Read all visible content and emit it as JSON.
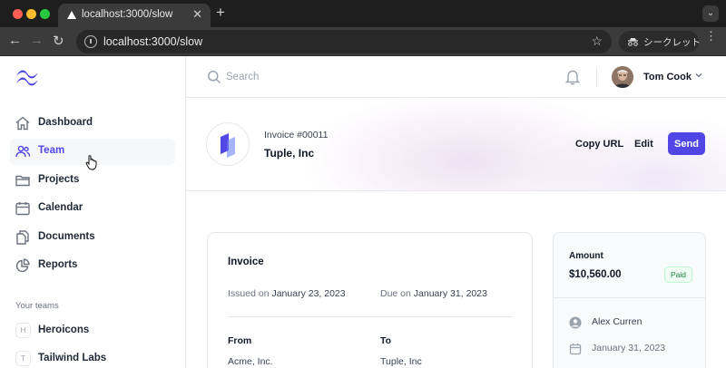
{
  "browser": {
    "tab_title": "localhost:3000/slow",
    "url": "localhost:3000/slow",
    "incognito_label": "シークレット"
  },
  "sidebar": {
    "items": [
      {
        "label": "Dashboard",
        "icon": "home-icon"
      },
      {
        "label": "Team",
        "icon": "users-icon"
      },
      {
        "label": "Projects",
        "icon": "folder-icon"
      },
      {
        "label": "Calendar",
        "icon": "calendar-icon"
      },
      {
        "label": "Documents",
        "icon": "documents-icon"
      },
      {
        "label": "Reports",
        "icon": "pie-chart-icon"
      }
    ],
    "active_item": "Team",
    "teams_title": "Your teams",
    "teams": [
      {
        "initial": "H",
        "label": "Heroicons"
      },
      {
        "initial": "T",
        "label": "Tailwind Labs"
      }
    ]
  },
  "topbar": {
    "search_placeholder": "Search",
    "user_name": "Tom Cook"
  },
  "header": {
    "invoice_number": "Invoice #00011",
    "company": "Tuple, Inc",
    "copy_url_label": "Copy URL",
    "edit_label": "Edit",
    "send_label": "Send"
  },
  "invoice": {
    "title": "Invoice",
    "issued_prefix": "Issued on",
    "issued_date": "January 23, 2023",
    "due_prefix": "Due on",
    "due_date": "January 31, 2023",
    "from_label": "From",
    "from_value": "Acme, Inc.",
    "to_label": "To",
    "to_value": "Tuple, Inc"
  },
  "summary": {
    "amount_label": "Amount",
    "amount_value": "$10,560.00",
    "status": "Paid",
    "client": "Alex Curren",
    "date": "January 31, 2023"
  },
  "colors": {
    "accent": "#4f46e5",
    "paid_text": "#15803d"
  }
}
